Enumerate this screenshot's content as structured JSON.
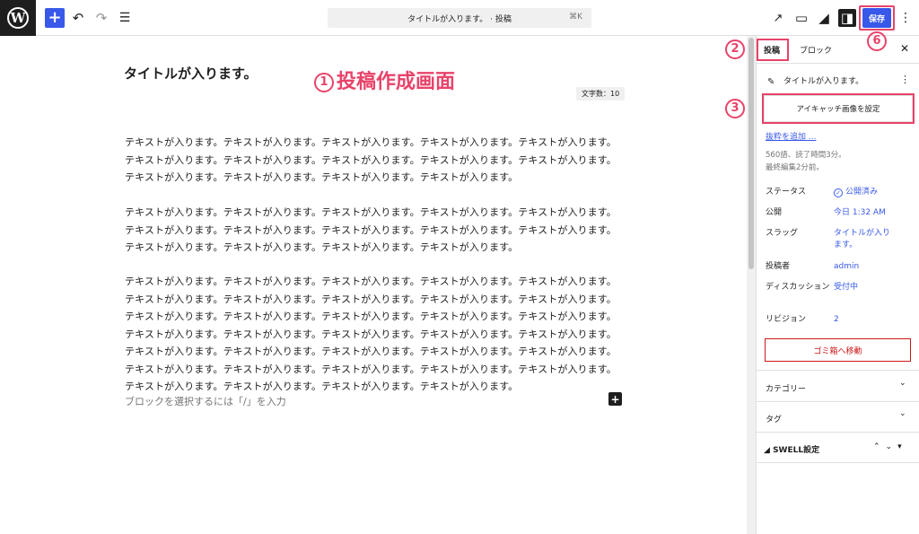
{
  "topbar": {
    "wp_logo_letter": "W",
    "add_icon": "+",
    "undo_icon": "↶",
    "redo_icon": "↷",
    "list_icon": "☰",
    "command_title": "タイトルが入ります。 · 投稿",
    "command_shortcut": "⌘K",
    "preview_icon": "↗",
    "view_icon": "▭",
    "swell_icon": "◢",
    "settings_icon": "◨",
    "save_label": "保存",
    "more_icon": "⋮"
  },
  "editor": {
    "post_title": "タイトルが入ります。",
    "annotation_num": "1",
    "annotation_text": "投稿作成画面",
    "char_count": "文字数：10",
    "paragraphs": [
      "テキストが入ります。テキストが入ります。テキストが入ります。テキストが入ります。テキストが入ります。テキストが入ります。テキストが入ります。テキストが入ります。テキストが入ります。テキストが入ります。テキストが入ります。テキストが入ります。テキストが入ります。テキストが入ります。",
      "テキストが入ります。テキストが入ります。テキストが入ります。テキストが入ります。テキストが入ります。テキストが入ります。テキストが入ります。テキストが入ります。テキストが入ります。テキストが入ります。テキストが入ります。テキストが入ります。テキストが入ります。テキストが入ります。",
      "テキストが入ります。テキストが入ります。テキストが入ります。テキストが入ります。テキストが入ります。テキストが入ります。テキストが入ります。テキストが入ります。テキストが入ります。テキストが入ります。テキストが入ります。テキストが入ります。テキストが入ります。テキストが入ります。テキストが入ります。テキストが入ります。テキストが入ります。テキストが入ります。テキストが入ります。テキストが入ります。テキストが入ります。テキストが入ります。テキストが入ります。テキストが入ります。テキストが入ります。テキストが入ります。テキストが入ります。テキストが入ります。テキストが入ります。テキストが入ります。テキストが入ります。テキストが入ります。テキストが入ります。テキストが入ります。"
    ],
    "block_placeholder": "ブロックを選択するには「/」を入力",
    "inline_add_icon": "+"
  },
  "sidebar": {
    "tab_post": "投稿",
    "tab_block": "ブロック",
    "close_icon": "✕",
    "annotation_2": "2",
    "annotation_3": "3",
    "annotation_6": "6",
    "post_icon": "✎",
    "post_title": "タイトルが入ります。",
    "post_more_icon": "⋮",
    "featured_image_button": "アイキャッチ画像を設定",
    "excerpt_link": "抜粋を追加 ...",
    "word_info": "560語、読了時間3分。",
    "last_edited": "最終編集2分前。",
    "status_label": "ステータス",
    "status_check": "✓",
    "status_value": "公開済み",
    "publish_label": "公開",
    "publish_value": "今日 1:32 AM",
    "slug_label": "スラッグ",
    "slug_value": "タイトルが入ります。",
    "author_label": "投稿者",
    "author_value": "admin",
    "discussion_label": "ディスカッション",
    "discussion_value": "受付中",
    "revisions_label": "リビジョン",
    "revisions_value": "2",
    "trash_button": "ゴミ箱へ移動",
    "category_label": "カテゴリー",
    "category_chevron": "⌄",
    "tag_label": "タグ",
    "tag_chevron": "⌄",
    "swell_settings": "SWELL設定",
    "swell_icon": "◢",
    "swell_controls": "⌃⌄▾"
  },
  "colors": {
    "accent": "#3858e9",
    "annotation": "#e8436a",
    "danger": "#cc1818"
  }
}
